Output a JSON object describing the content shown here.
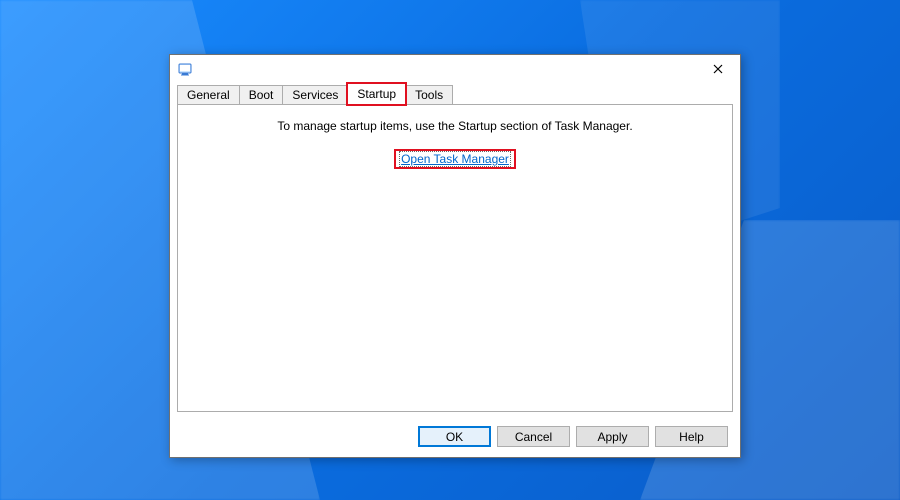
{
  "tabs": {
    "general": "General",
    "boot": "Boot",
    "services": "Services",
    "startup": "Startup",
    "tools": "Tools"
  },
  "content": {
    "info": "To manage startup items, use the Startup section of Task Manager.",
    "link": "Open Task Manager"
  },
  "buttons": {
    "ok": "OK",
    "cancel": "Cancel",
    "apply": "Apply",
    "help": "Help"
  }
}
